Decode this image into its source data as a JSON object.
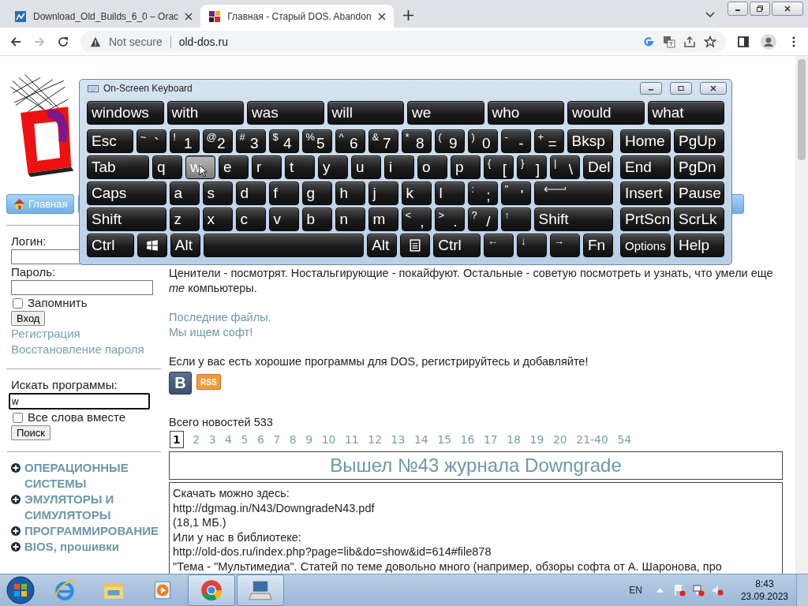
{
  "browser": {
    "tabs": [
      {
        "title": "Download_Old_Builds_6_0 – Orac",
        "kind": "blue",
        "selected": false
      },
      {
        "title": "Главная - Старый DOS. Abandon",
        "kind": "msdos",
        "selected": true
      }
    ],
    "security": "Not secure",
    "url": "old-dos.ru"
  },
  "page": {
    "nav": [
      {
        "label": "Главная"
      }
    ],
    "login": {
      "login_label": "Логин:",
      "password_label": "Пароль:",
      "remember": {
        "label": "Запомнить",
        "checked": false
      },
      "submit": "Вход",
      "links": [
        "Регистрация",
        "Восстановление пароля"
      ]
    },
    "search": {
      "label": "Искать программы:",
      "value": "w",
      "all_words": {
        "label": "Все слова вместе",
        "checked": false
      },
      "submit": "Поиск"
    },
    "categories": [
      "ОПЕРАЦИОННЫЕ СИСТЕМЫ",
      "ЭМУЛЯТОРЫ И СИМУЛЯТОРЫ",
      "ПРОГРАММИРОВАНИЕ",
      "BIOS, прошивки"
    ],
    "intro": "Ценители - посмотрят. Ностальгирующие - покайфуют. Остальные - советую посмотреть и узнать, что умели еще *те* компьютеры.",
    "links": [
      "Последние файлы.",
      "Мы ищем софт!"
    ],
    "invite": "Если у вас есть хорошие программы для DOS, регистрируйтесь и добавляйте!",
    "vk": "B",
    "rss": "RSS",
    "news_count": "Всего новостей 533",
    "pages": [
      {
        "label": "1",
        "selected": true
      },
      {
        "label": "2",
        "selected": false
      },
      {
        "label": "3",
        "selected": false
      },
      {
        "label": "4",
        "selected": false
      },
      {
        "label": "5",
        "selected": false
      },
      {
        "label": "6",
        "selected": false
      },
      {
        "label": "7",
        "selected": false
      },
      {
        "label": "8",
        "selected": false
      },
      {
        "label": "9",
        "selected": false
      },
      {
        "label": "10",
        "selected": false
      },
      {
        "label": "11",
        "selected": false
      },
      {
        "label": "12",
        "selected": false
      },
      {
        "label": "13",
        "selected": false
      },
      {
        "label": "14",
        "selected": false
      },
      {
        "label": "15",
        "selected": false
      },
      {
        "label": "16",
        "selected": false
      },
      {
        "label": "17",
        "selected": false
      },
      {
        "label": "18",
        "selected": false
      },
      {
        "label": "19",
        "selected": false
      },
      {
        "label": "20",
        "selected": false
      },
      {
        "label": "21-40",
        "selected": false
      },
      {
        "label": "54",
        "selected": false
      }
    ],
    "article": {
      "title": "Вышел №43 журнала Downgrade",
      "lines": [
        "Скачать можно здесь:",
        "http://dgmag.in/N43/DowngradeN43.pdf",
        "(18,1 МБ.)",
        "Или у нас в библиотеке:",
        "http://old-dos.ru/index.php?page=lib&do=show&id=614#file878",
        "\"Тема - \"Мультимедиа\". Статей по теме довольно много (например, обзоры софта от А. Шаронова, про"
      ]
    }
  },
  "keyboard": {
    "title": "On-Screen Keyboard",
    "suggestions": [
      "windows",
      "with",
      "was",
      "will",
      "we",
      "who",
      "would",
      "what"
    ],
    "rows": [
      {
        "keys": [
          {
            "label": "Esc",
            "kind": "wide",
            "hovered": false
          },
          {
            "shift": "~",
            "label": "`",
            "kind": "char",
            "hovered": false
          },
          {
            "shift": "!",
            "label": "1",
            "kind": "char",
            "hovered": false
          },
          {
            "shift": "@",
            "label": "2",
            "kind": "char",
            "hovered": false
          },
          {
            "shift": "#",
            "label": "3",
            "kind": "char",
            "hovered": false
          },
          {
            "shift": "$",
            "label": "4",
            "kind": "char",
            "hovered": false
          },
          {
            "shift": "%",
            "label": "5",
            "kind": "char",
            "hovered": false
          },
          {
            "shift": "^",
            "label": "6",
            "kind": "char",
            "hovered": false
          },
          {
            "shift": "&",
            "label": "7",
            "kind": "char",
            "hovered": false
          },
          {
            "shift": "*",
            "label": "8",
            "kind": "char",
            "hovered": false
          },
          {
            "shift": "(",
            "label": "9",
            "kind": "char",
            "hovered": false
          },
          {
            "shift": ")",
            "label": "0",
            "kind": "char",
            "hovered": false
          },
          {
            "shift": "-",
            "label": "-",
            "kind": "char",
            "hovered": false
          },
          {
            "shift": "+",
            "label": "=",
            "kind": "char",
            "hovered": false
          },
          {
            "label": "Bksp",
            "kind": "wide",
            "hovered": false
          }
        ],
        "side": [
          {
            "label": "Home",
            "kind": "side",
            "hovered": false
          },
          {
            "label": "PgUp",
            "kind": "side",
            "hovered": false
          }
        ]
      },
      {
        "keys": [
          {
            "label": "Tab",
            "kind": "wide",
            "hovered": false
          },
          {
            "label": "q",
            "kind": "char",
            "hovered": false
          },
          {
            "label": "w",
            "kind": "char",
            "hovered": true
          },
          {
            "label": "e",
            "kind": "char",
            "hovered": false
          },
          {
            "label": "r",
            "kind": "char",
            "hovered": false
          },
          {
            "label": "t",
            "kind": "char",
            "hovered": false
          },
          {
            "label": "y",
            "kind": "char",
            "hovered": false
          },
          {
            "label": "u",
            "kind": "char",
            "hovered": false
          },
          {
            "label": "i",
            "kind": "char",
            "hovered": false
          },
          {
            "label": "o",
            "kind": "char",
            "hovered": false
          },
          {
            "label": "p",
            "kind": "char",
            "hovered": false
          },
          {
            "shift": "{",
            "label": "[",
            "kind": "char",
            "hovered": false
          },
          {
            "shift": "}",
            "label": "]",
            "kind": "char",
            "hovered": false
          },
          {
            "shift": "|",
            "label": "\\",
            "kind": "char",
            "hovered": false
          },
          {
            "label": "Del",
            "kind": "char",
            "hovered": false
          }
        ],
        "side": [
          {
            "label": "End",
            "kind": "side",
            "hovered": false
          },
          {
            "label": "PgDn",
            "kind": "side",
            "hovered": false
          }
        ]
      },
      {
        "keys": [
          {
            "label": "Caps",
            "kind": "wide",
            "hovered": false
          },
          {
            "label": "a",
            "kind": "char",
            "hovered": false
          },
          {
            "label": "s",
            "kind": "char",
            "hovered": false
          },
          {
            "label": "d",
            "kind": "char",
            "hovered": false
          },
          {
            "label": "f",
            "kind": "char",
            "hovered": false
          },
          {
            "label": "g",
            "kind": "char",
            "hovered": false
          },
          {
            "label": "h",
            "kind": "char",
            "hovered": false
          },
          {
            "label": "j",
            "kind": "char",
            "hovered": false
          },
          {
            "label": "k",
            "kind": "char",
            "hovered": false
          },
          {
            "label": "l",
            "kind": "char",
            "hovered": false
          },
          {
            "shift": ":",
            "label": ";",
            "kind": "char",
            "hovered": false
          },
          {
            "shift": "\"",
            "label": "'",
            "kind": "char",
            "hovered": false
          },
          {
            "kind": "enter",
            "hovered": false
          }
        ],
        "side": [
          {
            "label": "Insert",
            "kind": "side",
            "hovered": false
          },
          {
            "label": "Pause",
            "kind": "side",
            "hovered": false
          }
        ]
      },
      {
        "keys": [
          {
            "label": "Shift",
            "kind": "wide",
            "hovered": false
          },
          {
            "label": "z",
            "kind": "char",
            "hovered": false
          },
          {
            "label": "x",
            "kind": "char",
            "hovered": false
          },
          {
            "label": "c",
            "kind": "char",
            "hovered": false
          },
          {
            "label": "v",
            "kind": "char",
            "hovered": false
          },
          {
            "label": "b",
            "kind": "char",
            "hovered": false
          },
          {
            "label": "n",
            "kind": "char",
            "hovered": false
          },
          {
            "label": "m",
            "kind": "char",
            "hovered": false
          },
          {
            "shift": "<",
            "label": ",",
            "kind": "char",
            "hovered": false
          },
          {
            "shift": ">",
            "label": ".",
            "kind": "char",
            "hovered": false
          },
          {
            "shift": "?",
            "label": "/",
            "kind": "char",
            "hovered": false
          },
          {
            "shift": "↑",
            "kind": "char",
            "hovered": false
          },
          {
            "label": "Shift",
            "kind": "wide",
            "hovered": false
          }
        ],
        "side": [
          {
            "label": "PrtScn",
            "kind": "side",
            "hovered": false
          },
          {
            "label": "ScrLk",
            "kind": "side",
            "hovered": false
          }
        ]
      },
      {
        "keys": [
          {
            "label": "Ctrl",
            "kind": "wide",
            "hovered": false
          },
          {
            "kind": "windows",
            "hovered": false
          },
          {
            "label": "Alt",
            "kind": "char",
            "hovered": false
          },
          {
            "kind": "space",
            "hovered": false
          },
          {
            "label": "Alt",
            "kind": "char",
            "hovered": false
          },
          {
            "kind": "menu",
            "hovered": false
          },
          {
            "label": "Ctrl",
            "kind": "wide",
            "hovered": false
          },
          {
            "shift": "←",
            "kind": "char",
            "hovered": false
          },
          {
            "shift": "↓",
            "kind": "char",
            "hovered": false
          },
          {
            "shift": "→",
            "kind": "char",
            "hovered": false
          },
          {
            "label": "Fn",
            "kind": "char",
            "hovered": false
          }
        ],
        "side": [
          {
            "label": "Options",
            "kind": "side-small",
            "hovered": false
          },
          {
            "label": "Help",
            "kind": "side",
            "hovered": false
          }
        ]
      }
    ]
  },
  "taskbar": {
    "apps": [
      {
        "kind": "ie",
        "active": false
      },
      {
        "kind": "folder",
        "active": false
      },
      {
        "kind": "media",
        "active": false
      },
      {
        "kind": "chrome",
        "active": true
      },
      {
        "kind": "keyboard",
        "active": true
      }
    ],
    "lang": "EN",
    "time": "8:43",
    "date": "23.09.2023"
  }
}
